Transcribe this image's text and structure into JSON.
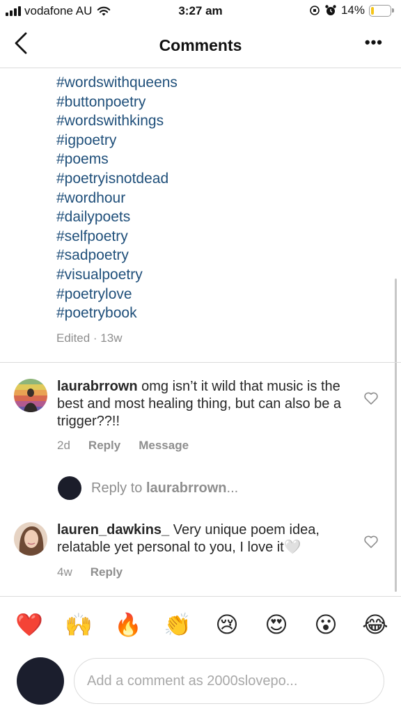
{
  "status_bar": {
    "carrier": "vodafone AU",
    "time": "3:27 am",
    "battery_percent": "14%",
    "battery_level": 0.14,
    "battery_color": "#f5c518"
  },
  "header": {
    "title": "Comments",
    "back_icon": "chevron-left-icon",
    "more_label": "•••"
  },
  "caption": {
    "hashtags": [
      "#wordswithqueens",
      "#buttonpoetry",
      "#wordswithkings",
      "#igpoetry",
      "#poems",
      "#poetryisnotdead",
      "#wordhour",
      "#dailypoets",
      "#selfpoetry",
      "#sadpoetry",
      "#visualpoetry",
      "#poetrylove",
      "#poetrybook"
    ],
    "meta": "Edited · 13w",
    "hashtag_color": "#1f4f7a"
  },
  "comments": [
    {
      "username": "laurabrrown",
      "text": "omg isn’t it wild that music is the best and most healing thing, but can also be a trigger??!!",
      "time": "2d",
      "reply_label": "Reply",
      "message_label": "Message"
    },
    {
      "username": "lauren_dawkins_",
      "text": "Very unique poem idea, relatable yet personal to you, I love it🤍",
      "time": "4w",
      "reply_label": "Reply"
    }
  ],
  "reply_prompt": {
    "prefix": "Reply to",
    "username": "laurabrrown",
    "suffix": "..."
  },
  "emoji_bar": [
    "❤️",
    "🙌",
    "🔥",
    "👏",
    "😢",
    "😍",
    "😮",
    "😂"
  ],
  "composer": {
    "placeholder": "Add a comment as 2000slovepo..."
  }
}
